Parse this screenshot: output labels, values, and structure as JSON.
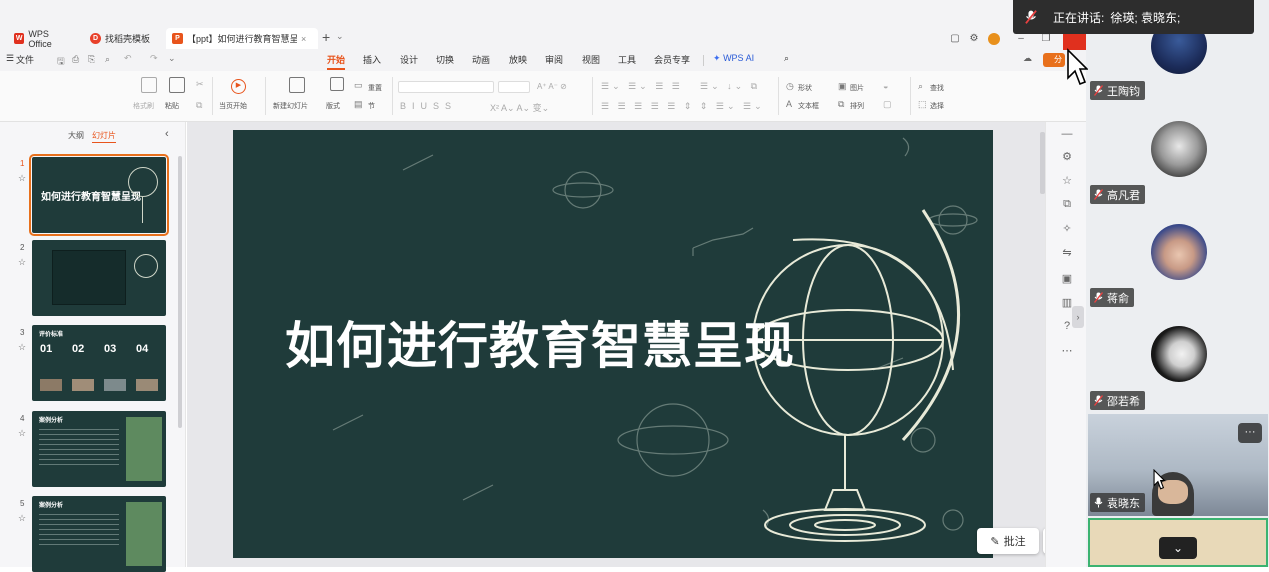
{
  "titlebar": {
    "tabs": [
      {
        "label": "WPS Office"
      },
      {
        "label": "找稻壳模板"
      },
      {
        "label": "【ppt】如何进行教育智慧呈"
      }
    ],
    "new_tab": "+",
    "tab_menu": "⌄"
  },
  "menu": {
    "file": "文件",
    "items": [
      "开始",
      "插入",
      "设计",
      "切换",
      "动画",
      "放映",
      "审阅",
      "视图",
      "工具",
      "会员专享"
    ],
    "wps_ai": "WPS AI",
    "share": "分"
  },
  "ribbon": {
    "format_painter": "格式刷",
    "paste": "粘贴",
    "play_from_current": "当页开始",
    "new_slide": "新建幻灯片",
    "layout": "版式",
    "section": "节",
    "reset": "重置",
    "shape": "形状",
    "image": "图片",
    "textbox": "文本框",
    "arrange": "排列",
    "find": "查找",
    "select": "选择"
  },
  "panel": {
    "tab_outline": "大纲",
    "tab_slides": "幻灯片",
    "collapse": "‹",
    "slides": [
      {
        "num": "1",
        "title": "如何进行教育智慧呈现"
      },
      {
        "num": "2"
      },
      {
        "num": "3",
        "title": "评价标准",
        "items": [
          "01",
          "02",
          "03",
          "04"
        ]
      },
      {
        "num": "4",
        "title": "案例分析"
      },
      {
        "num": "5",
        "title": "案例分析"
      }
    ]
  },
  "slide": {
    "title": "如何进行教育智慧呈现"
  },
  "canvas_tools": {
    "comment": "批注"
  },
  "meeting": {
    "speaking_label": "正在讲话:",
    "speaking_names": "徐瑛; 袁晓东;",
    "participants": [
      {
        "name": "王陶钧"
      },
      {
        "name": "高凡君"
      },
      {
        "name": "蒋俞"
      },
      {
        "name": "邵若希"
      },
      {
        "name": "袁晓东"
      }
    ],
    "more": "···",
    "expand": "⌄"
  },
  "colors": {
    "accent": "#e8541c",
    "slide_bg": "#1f3b3a",
    "panel_bg": "#eceef1",
    "selected_outline": "#e8701c"
  }
}
